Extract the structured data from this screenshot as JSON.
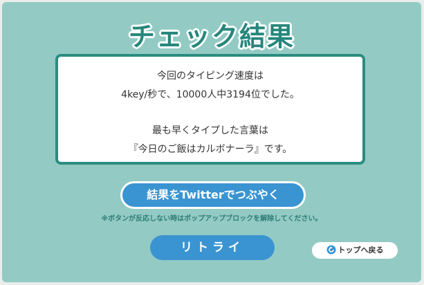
{
  "title": "チェック結果",
  "result": {
    "line1": "今回のタイピング速度は",
    "line2": "4key/秒で、10000人中3194位でした。",
    "line3": "最も早くタイプした言葉は",
    "line4": "『今日のご飯はカルボナーラ』です。"
  },
  "buttons": {
    "twitter_label": "結果をTwitterでつぶやく",
    "retry_label": "リトライ",
    "top_label": "トップへ戻る"
  },
  "note": "※ボタンが反応しない時はポップアップブロックを解除してください。",
  "colors": {
    "panel": "#93cac4",
    "accent": "#2a8c80",
    "button": "#3a94d2"
  },
  "icons": {
    "top_button": "refresh-icon"
  }
}
